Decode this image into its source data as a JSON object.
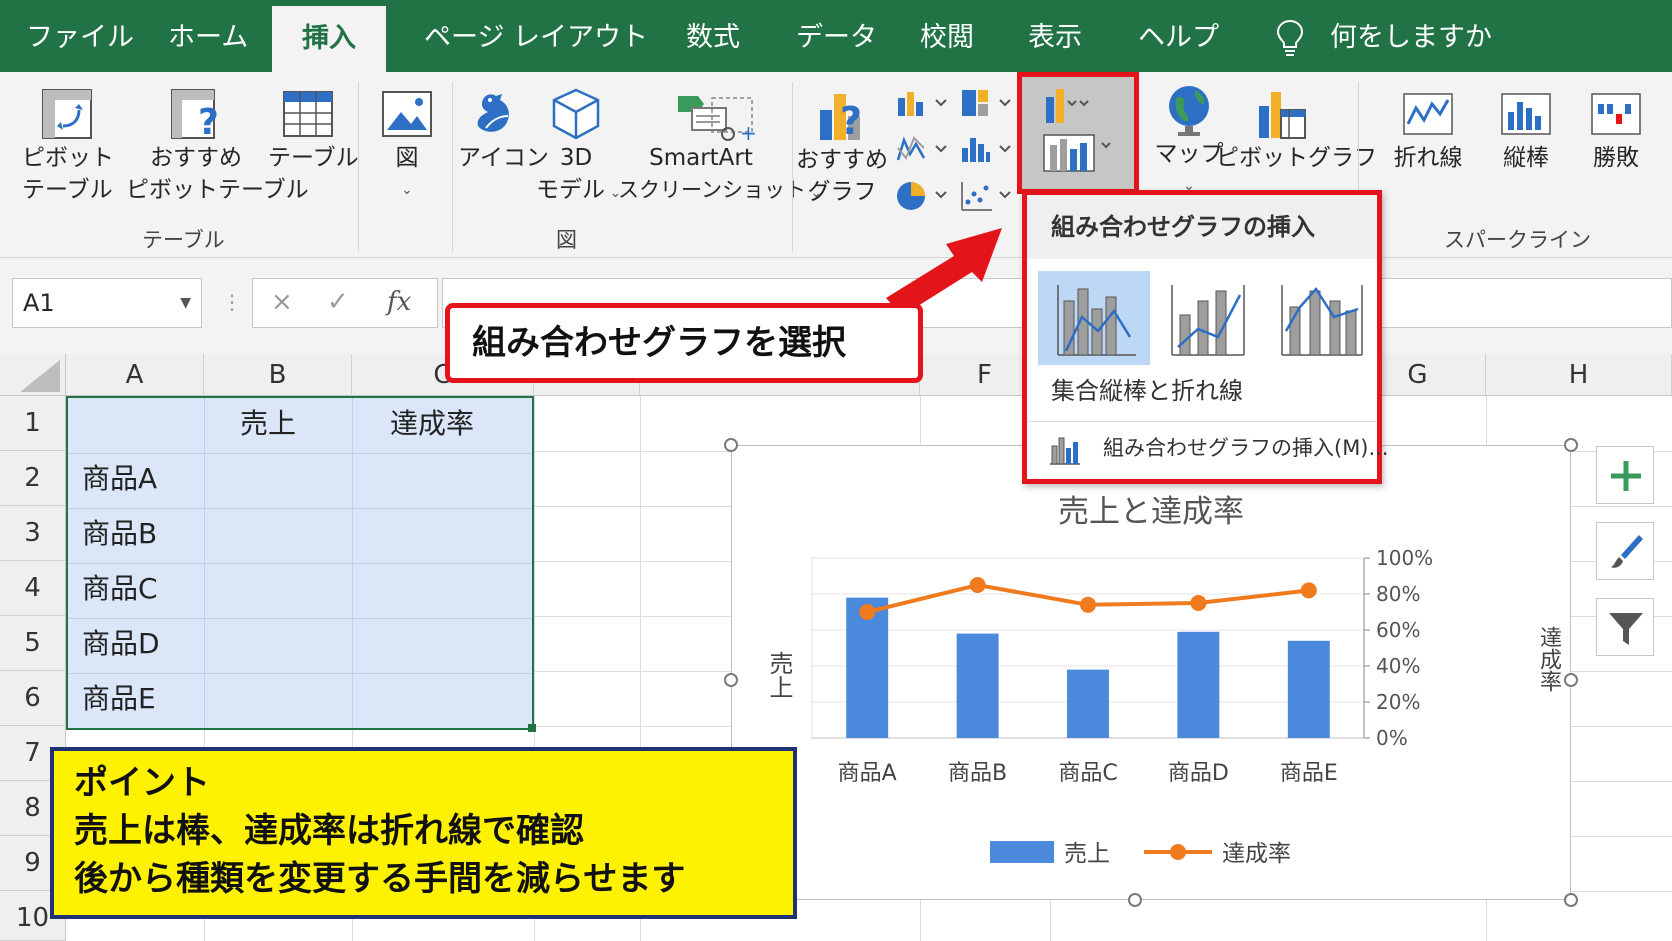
{
  "tabs": [
    "ファイル",
    "ホーム",
    "挿入",
    "ページ レイアウト",
    "数式",
    "データ",
    "校閲",
    "表示",
    "ヘルプ"
  ],
  "active_tab": "挿入",
  "tell_me": "何をしますか",
  "ribbon": {
    "pivot_table": [
      "ピボット",
      "テーブル"
    ],
    "recommended_pivot": [
      "おすすめ",
      "ピボットテーブル"
    ],
    "table": "テーブル",
    "group_table": "テーブル",
    "image": "図",
    "icons": "アイコン",
    "model3d": [
      "3D",
      "モデル"
    ],
    "smartart": "SmartArt",
    "screenshot": "スクリーンショット",
    "group_illustrations": "図",
    "recommended_charts": [
      "おすすめ",
      "グラフ"
    ],
    "map": "マップ",
    "pivot_chart": "ピボットグラフ",
    "spark_line": "折れ線",
    "spark_column": "縦棒",
    "spark_winloss": "勝敗",
    "group_sparklines": "スパークライン"
  },
  "formula_bar": {
    "name_box": "A1",
    "cancel": "×",
    "enter": "✓",
    "fx": "fx"
  },
  "grid": {
    "columns": [
      "A",
      "B",
      "C",
      "F",
      "G",
      "H"
    ],
    "rows": [
      "1",
      "2",
      "3",
      "4",
      "5",
      "6",
      "7",
      "8",
      "9",
      "10"
    ],
    "header_row": [
      "",
      "売上",
      "達成率"
    ],
    "products": [
      "商品A",
      "商品B",
      "商品C",
      "商品D",
      "商品E"
    ]
  },
  "dropdown": {
    "title": "組み合わせグラフの挿入",
    "selected_option": "集合縦棒と折れ線",
    "more": "組み合わせグラフの挿入(M)..."
  },
  "callout_red": "組み合わせグラフを選択",
  "callout_yellow": {
    "heading": "ポイント",
    "line1": "売上は棒、達成率は折れ線で確認",
    "line2": "後から種類を変更する手間を減らせます"
  },
  "chart_side_buttons": [
    "plus-icon",
    "brush-icon",
    "filter-icon"
  ],
  "colors": {
    "excel_green": "#217346",
    "bar_blue": "#4a89dc",
    "line_orange": "#f07b1e",
    "highlight_red": "#e3141a",
    "callout_yellow": "#fff200"
  },
  "chart_data": {
    "type": "bar",
    "title": "売上と達成率",
    "categories": [
      "商品A",
      "商品B",
      "商品C",
      "商品D",
      "商品E"
    ],
    "series": [
      {
        "name": "売上",
        "type": "bar",
        "axis": "left",
        "values": [
          78,
          58,
          38,
          59,
          54
        ]
      },
      {
        "name": "達成率",
        "type": "line",
        "axis": "right",
        "values": [
          0.7,
          0.85,
          0.74,
          0.75,
          0.82
        ]
      }
    ],
    "ylabel": "売上",
    "y2label": "達成率",
    "ylim": [
      0,
      100
    ],
    "y2lim": [
      0,
      1
    ],
    "y2ticks": [
      "0%",
      "20%",
      "40%",
      "60%",
      "80%",
      "100%"
    ],
    "legend": "bottom",
    "grid": true
  }
}
